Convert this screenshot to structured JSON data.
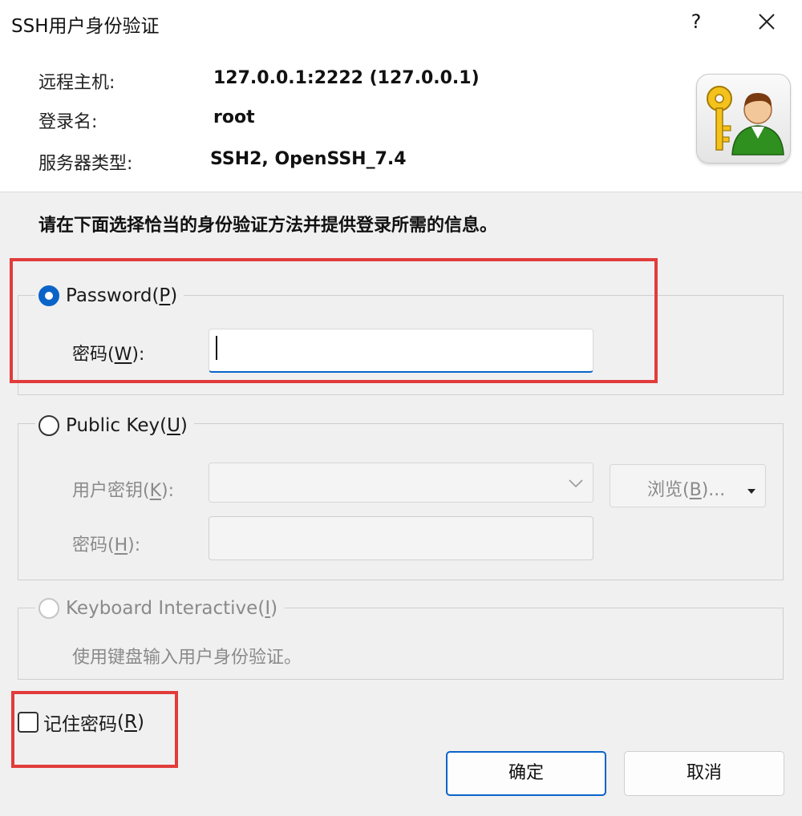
{
  "window": {
    "title": "SSH用户身份验证",
    "help_label": "?",
    "close_icon": "close-icon"
  },
  "info": {
    "host_label": "远程主机:",
    "host_value": "127.0.0.1:2222 (127.0.0.1)",
    "login_label": "登录名:",
    "login_value": "root",
    "server_type_label": "服务器类型:",
    "server_type_value": "SSH2, OpenSSH_7.4",
    "icon": "key-user-icon"
  },
  "instruction": "请在下面选择恰当的身份验证方法并提供登录所需的信息。",
  "password_method": {
    "label": "Password",
    "mnemonic": "P",
    "selected": true,
    "field_label": "密码",
    "field_mnemonic": "W",
    "field_value": ""
  },
  "publickey_method": {
    "label": "Public Key",
    "mnemonic": "U",
    "selected": false,
    "key_label": "用户密钥",
    "key_mnemonic": "K",
    "key_value": "",
    "browse_label": "浏览",
    "browse_mnemonic": "B",
    "browse_suffix": "...",
    "passphrase_label": "密码",
    "passphrase_mnemonic": "H",
    "passphrase_value": ""
  },
  "keyboard_method": {
    "label": "Keyboard Interactive",
    "mnemonic": "I",
    "selected": false,
    "description": "使用键盘输入用户身份验证。"
  },
  "remember": {
    "label": "记住密码",
    "mnemonic": "R",
    "checked": false
  },
  "buttons": {
    "ok": "确定",
    "cancel": "取消"
  },
  "colors": {
    "accent": "#0a64c8",
    "highlight_box": "#e23b3b"
  }
}
